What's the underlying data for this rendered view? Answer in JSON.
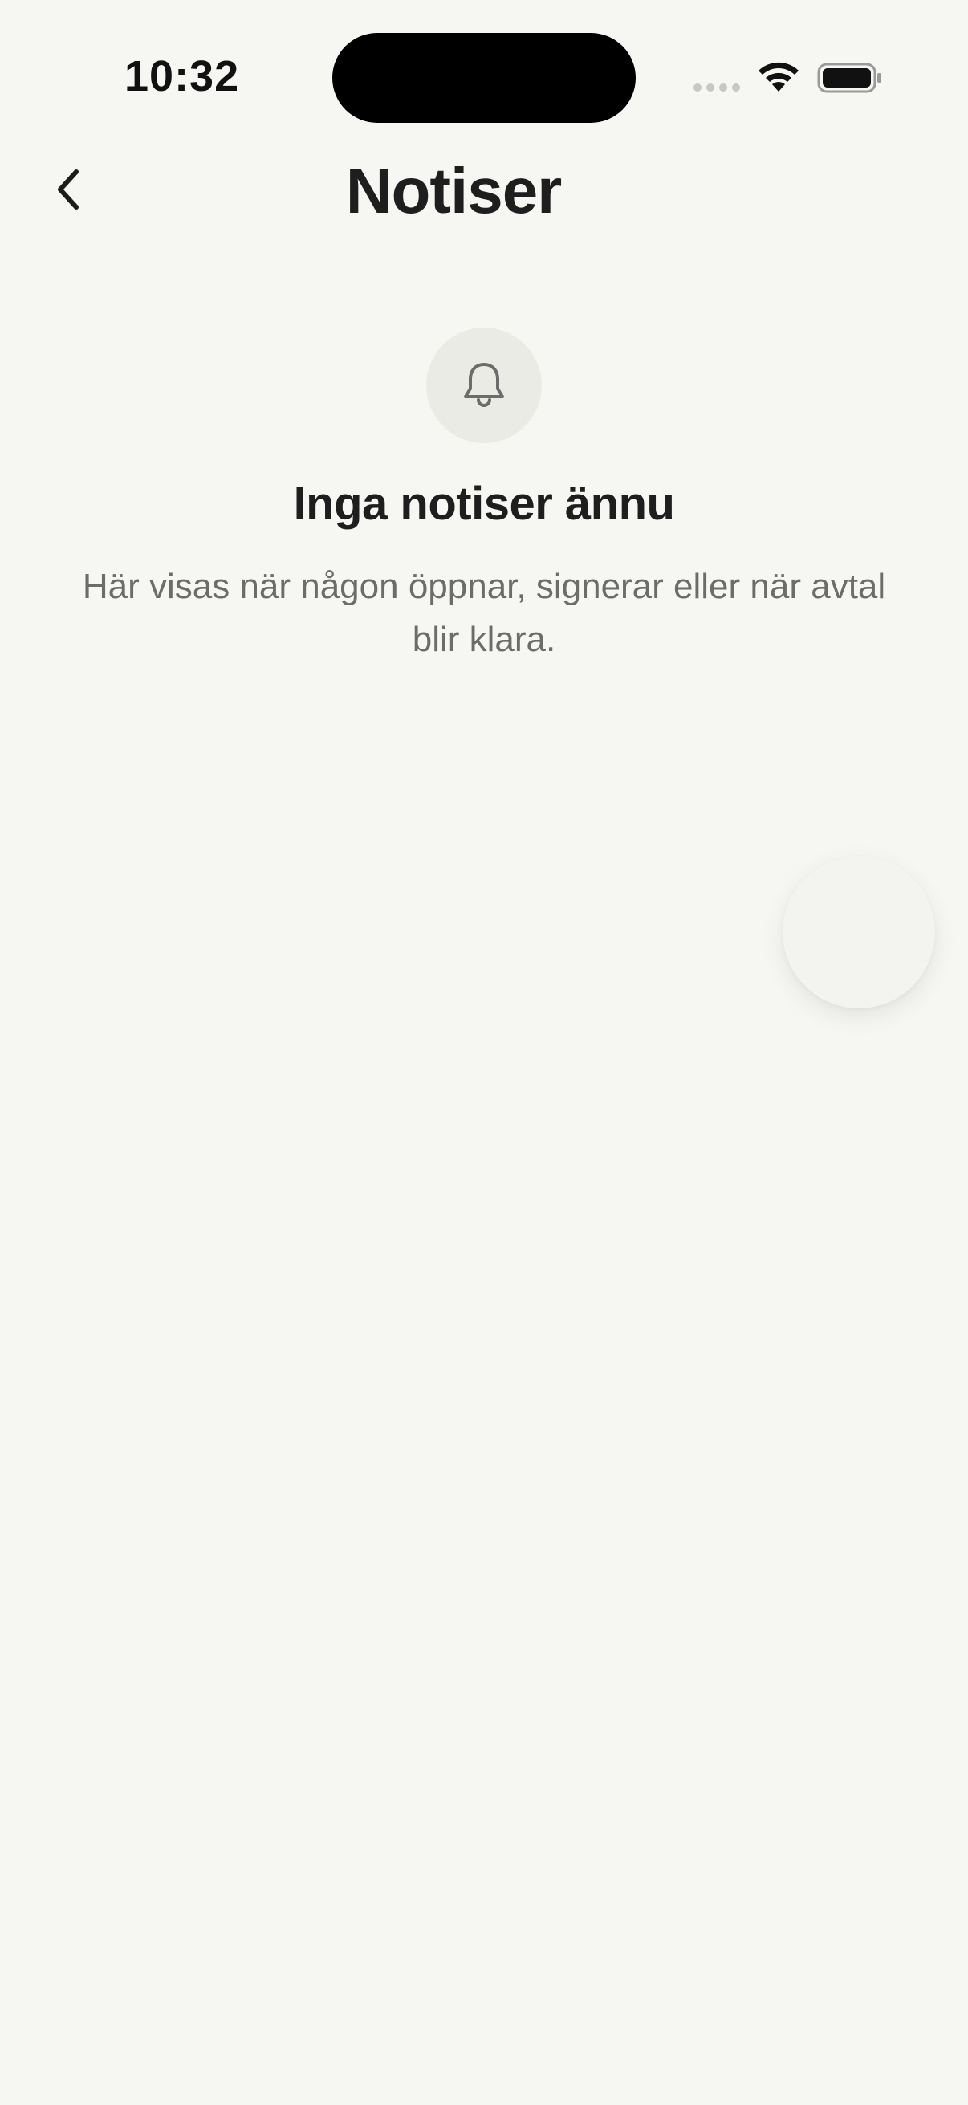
{
  "status_bar": {
    "time": "10:32"
  },
  "header": {
    "back_icon": "chevron-left-icon",
    "title": "Notiser"
  },
  "empty_state": {
    "icon": "bell-icon",
    "title": "Inga notiser ännu",
    "description": "Här visas när någon öppnar, signerar eller när avtal blir klara."
  },
  "colors": {
    "background": "#f6f6f2",
    "icon_circle": "#ebebe6",
    "secondary_text": "#6c6c6a",
    "primary_text": "#1e1e1e"
  }
}
